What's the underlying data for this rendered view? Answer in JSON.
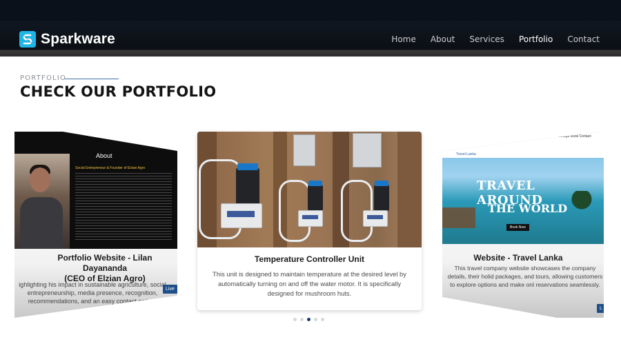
{
  "header": {
    "brand": "Sparkware",
    "nav": [
      {
        "label": "Home",
        "active": false
      },
      {
        "label": "About",
        "active": false
      },
      {
        "label": "Services",
        "active": false
      },
      {
        "label": "Portfolio",
        "active": true
      },
      {
        "label": "Contact",
        "active": false
      }
    ]
  },
  "section": {
    "eyebrow": "PORTFOLIO",
    "title": "CHECK OUR PORTFOLIO"
  },
  "cards": {
    "left": {
      "shot_heading": "About",
      "shot_subheading": "Social Entrepreneur & Founder of Elzian Agro",
      "title_line1": "Portfolio Website - Lilan Dayananda",
      "title_line2": "(CEO of Elzian Agro)",
      "desc": "ighlighting his impact in sustainable agriculture, social entrepreneurship, media presence, recognition, recommendations, and an easy contact option.",
      "button": "Live"
    },
    "center": {
      "title": "Temperature Controller Unit",
      "desc": "This unit is designed to maintain temperature at the desired level by automatically turning on and off the water motor. It is specifically designed for mushroom huts."
    },
    "right": {
      "shot_nav": "Home   About   Package   Book   Contact",
      "shot_brand": "Travel Lanka",
      "hero_line1": "TRAVEL AROUND",
      "hero_line2": "THE WORLD",
      "hero_button": "Book Now",
      "title": "Website - Travel Lanka",
      "desc": "This travel company website showcases the company details, their holid packages, and tours, allowing customers to explore options and make onl reservations seamlessly.",
      "button": "L"
    }
  },
  "carousel": {
    "dot_count": 5,
    "active_index": 2
  },
  "colors": {
    "accent": "#1a3a6a",
    "brand_icon": "#1fb6e6",
    "header_bg": "#0b111a"
  }
}
